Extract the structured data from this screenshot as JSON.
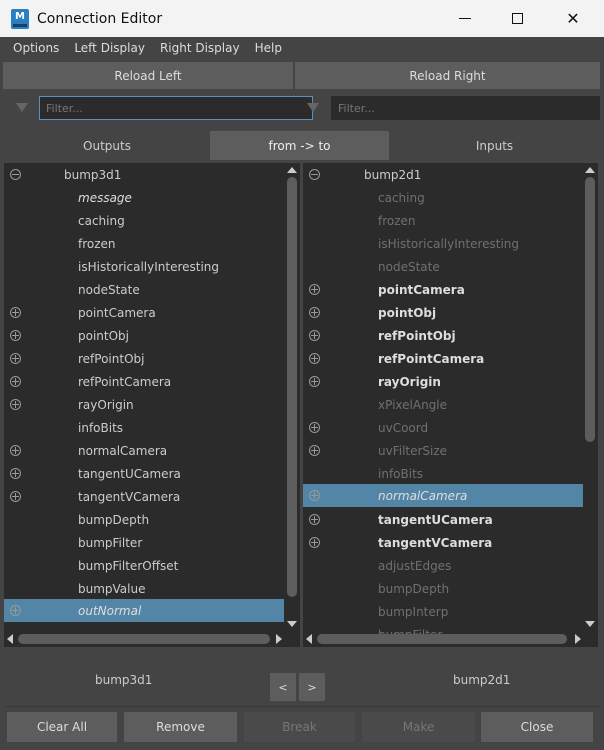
{
  "window": {
    "title": "Connection Editor",
    "logo": "M"
  },
  "menu": [
    "Options",
    "Left Display",
    "Right Display",
    "Help"
  ],
  "toolbar": {
    "reload_left": "Reload Left",
    "reload_right": "Reload Right"
  },
  "filters": {
    "left_placeholder": "Filter...",
    "right_placeholder": "Filter..."
  },
  "tabs": {
    "outputs": "Outputs",
    "mode": "from -> to",
    "inputs": "Inputs"
  },
  "left_list": {
    "node": "bump3d1",
    "items": [
      {
        "label": "message",
        "style": "italic"
      },
      {
        "label": "caching"
      },
      {
        "label": "frozen"
      },
      {
        "label": "isHistoricallyInteresting"
      },
      {
        "label": "nodeState"
      },
      {
        "label": "pointCamera",
        "expand": true
      },
      {
        "label": "pointObj",
        "expand": true
      },
      {
        "label": "refPointObj",
        "expand": true
      },
      {
        "label": "refPointCamera",
        "expand": true
      },
      {
        "label": "rayOrigin",
        "expand": true
      },
      {
        "label": "infoBits"
      },
      {
        "label": "normalCamera",
        "expand": true
      },
      {
        "label": "tangentUCamera",
        "expand": true
      },
      {
        "label": "tangentVCamera",
        "expand": true
      },
      {
        "label": "bumpDepth"
      },
      {
        "label": "bumpFilter"
      },
      {
        "label": "bumpFilterOffset"
      },
      {
        "label": "bumpValue"
      },
      {
        "label": "outNormal",
        "expand": true,
        "style": "italic",
        "selected": true
      }
    ]
  },
  "right_list": {
    "node": "bump2d1",
    "items": [
      {
        "label": "caching",
        "style": "dim"
      },
      {
        "label": "frozen",
        "style": "dim"
      },
      {
        "label": "isHistoricallyInteresting",
        "style": "dim"
      },
      {
        "label": "nodeState",
        "style": "dim"
      },
      {
        "label": "pointCamera",
        "expand": true,
        "style": "bold"
      },
      {
        "label": "pointObj",
        "expand": true,
        "style": "bold"
      },
      {
        "label": "refPointObj",
        "expand": true,
        "style": "bold"
      },
      {
        "label": "refPointCamera",
        "expand": true,
        "style": "bold"
      },
      {
        "label": "rayOrigin",
        "expand": true,
        "style": "bold"
      },
      {
        "label": "xPixelAngle",
        "style": "dim"
      },
      {
        "label": "uvCoord",
        "expand": true,
        "style": "dim"
      },
      {
        "label": "uvFilterSize",
        "expand": true,
        "style": "dim"
      },
      {
        "label": "infoBits",
        "style": "dim"
      },
      {
        "label": "normalCamera",
        "expand": true,
        "style": "italic",
        "selected": true
      },
      {
        "label": "tangentUCamera",
        "expand": true,
        "style": "bold"
      },
      {
        "label": "tangentVCamera",
        "expand": true,
        "style": "bold"
      },
      {
        "label": "adjustEdges",
        "style": "dim"
      },
      {
        "label": "bumpDepth",
        "style": "dim"
      },
      {
        "label": "bumpInterp",
        "style": "dim"
      },
      {
        "label": "bumpFilter",
        "style": "dim"
      }
    ]
  },
  "footer": {
    "left_node": "bump3d1",
    "right_node": "bump2d1",
    "prev": "<",
    "next": ">"
  },
  "buttons": {
    "clear_all": "Clear All",
    "remove": "Remove",
    "break": "Break",
    "make": "Make",
    "close": "Close"
  },
  "colors": {
    "selection": "#5285a6",
    "background": "#444444",
    "list_bg": "#2b2b2b"
  }
}
